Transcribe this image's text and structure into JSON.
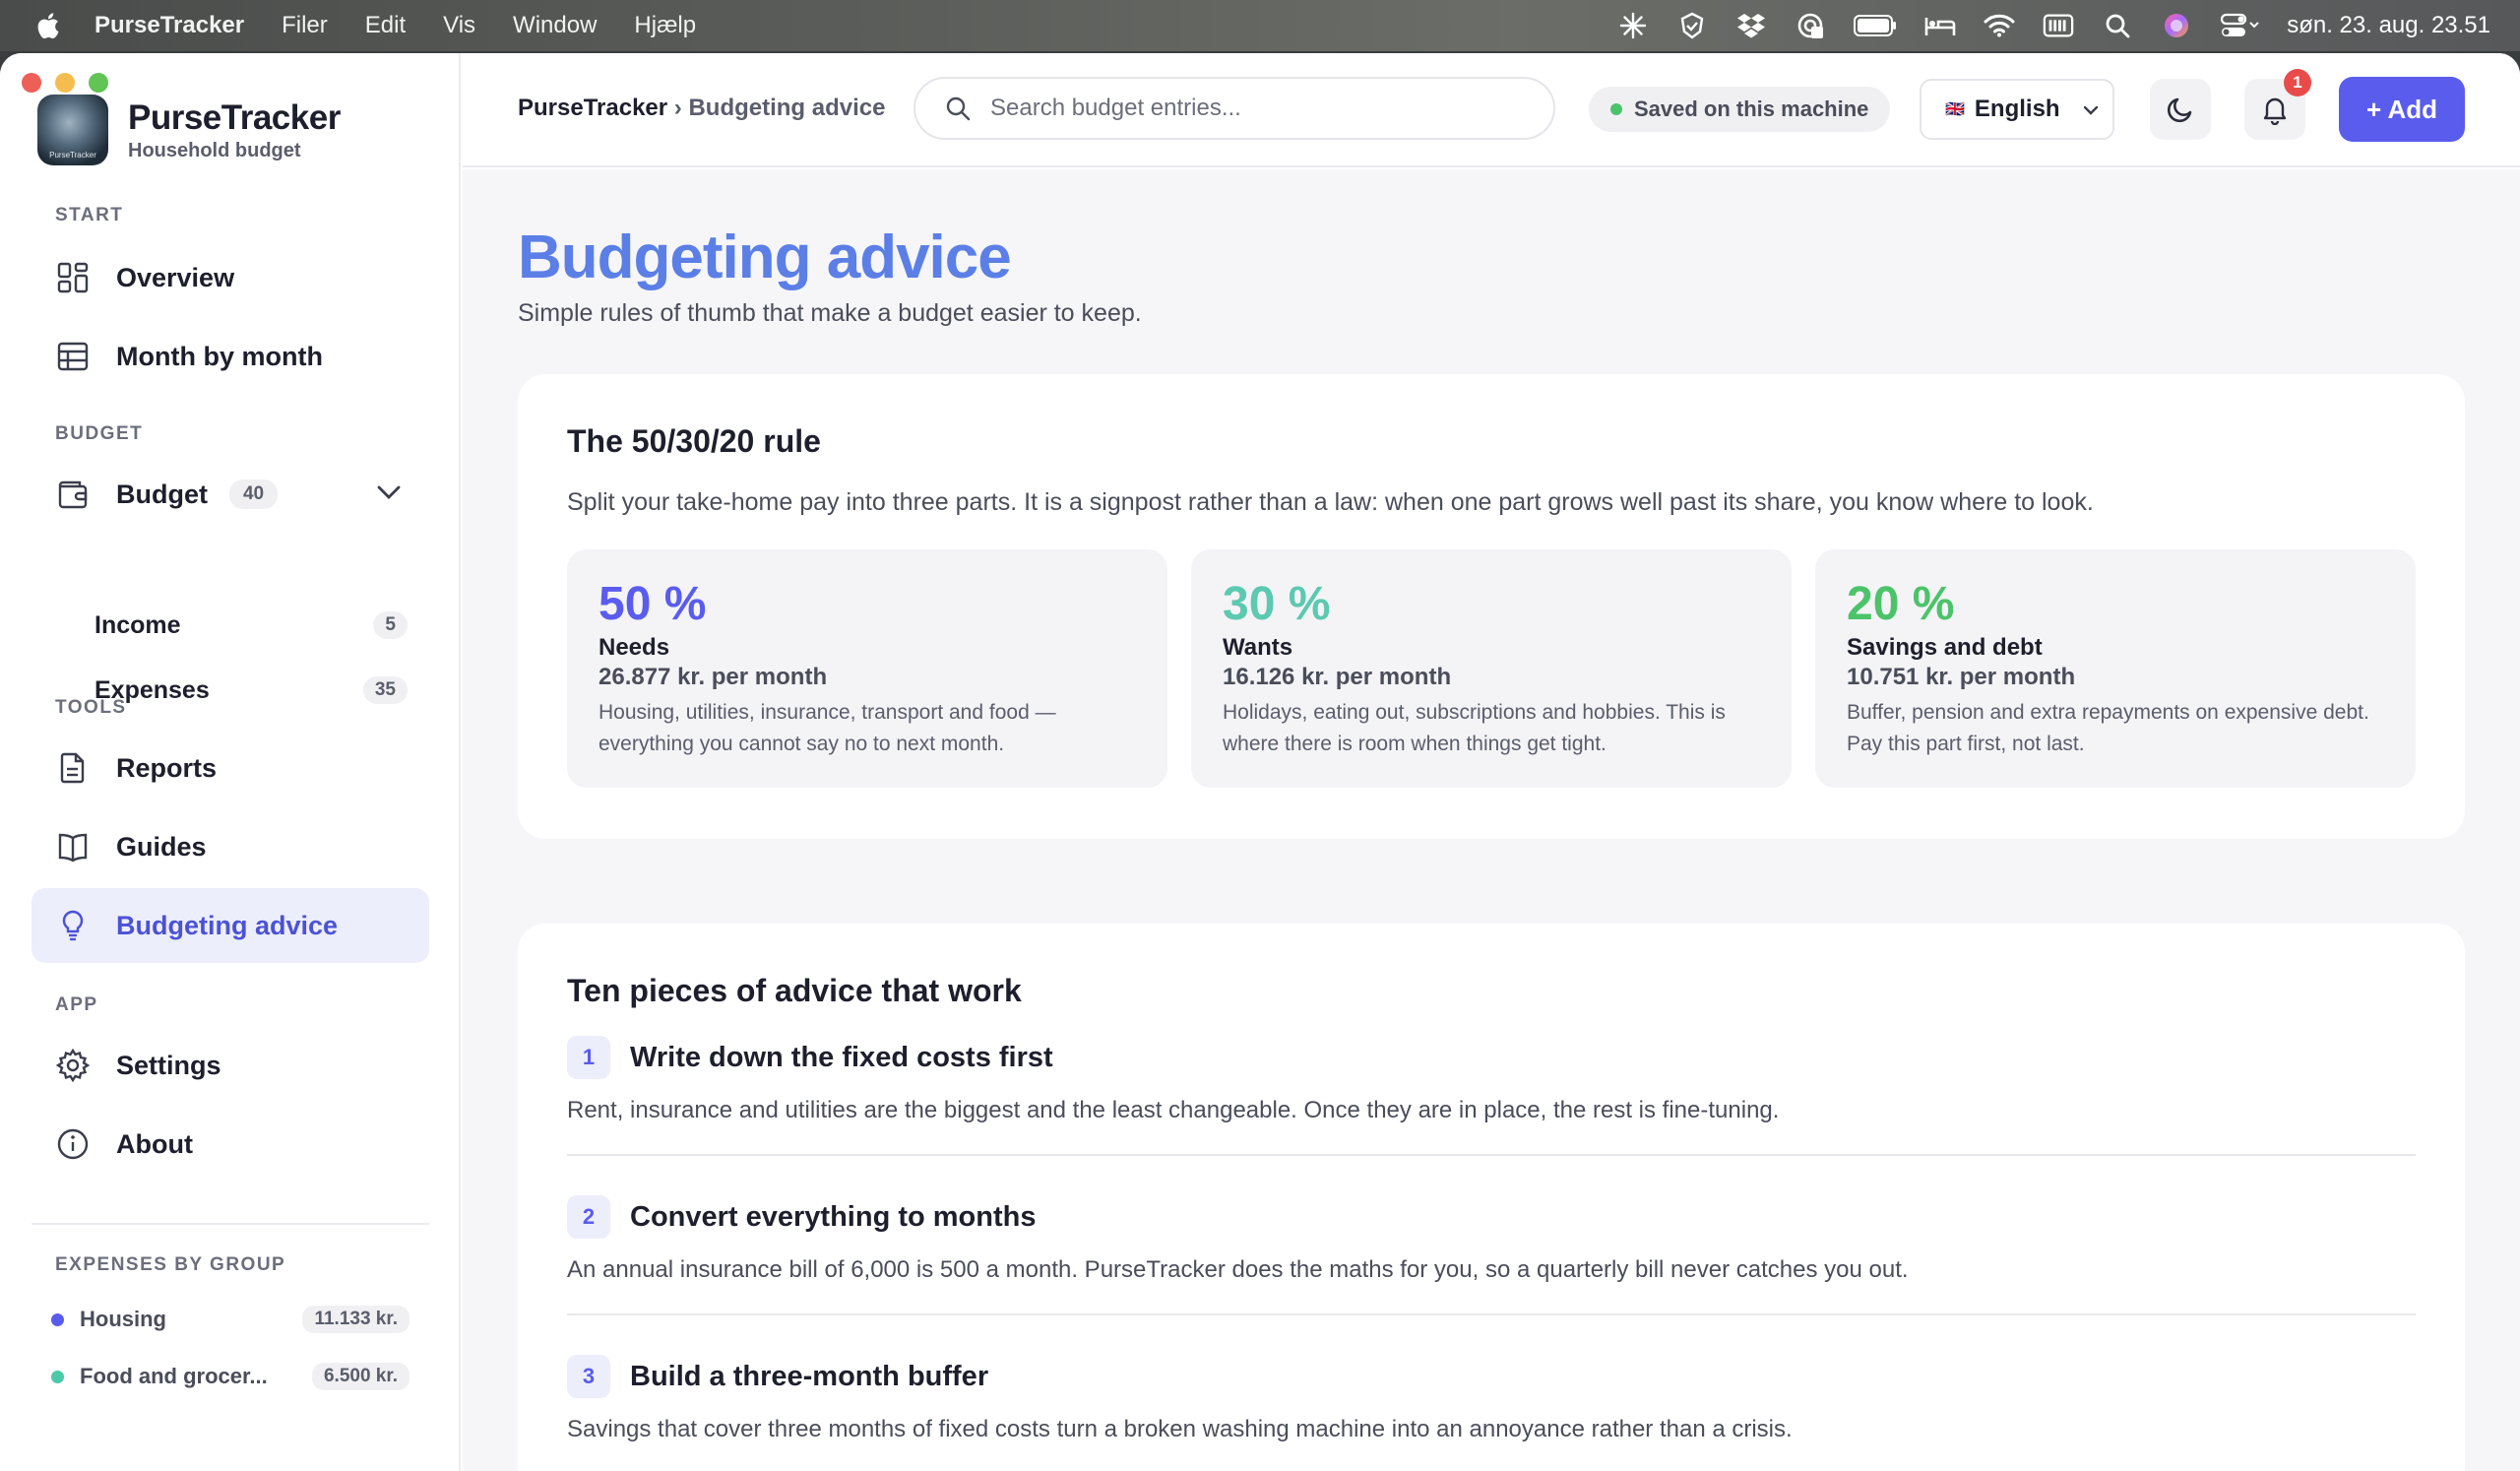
{
  "menubar": {
    "app_name": "PurseTracker",
    "menus": [
      "Filer",
      "Edit",
      "Vis",
      "Window",
      "Hjælp"
    ],
    "clock": "søn. 23. aug.  23.51"
  },
  "brand": {
    "name": "PurseTracker",
    "subtitle": "Household budget",
    "logo_text": "PurseTracker"
  },
  "sidebar": {
    "sections": {
      "start": "START",
      "budget": "BUDGET",
      "tools": "TOOLS",
      "app": "APP",
      "expenses_by_group": "EXPENSES BY GROUP"
    },
    "items": {
      "overview": "Overview",
      "month_by_month": "Month by month",
      "budget": "Budget",
      "budget_count": "40",
      "income": "Income",
      "income_count": "5",
      "expenses": "Expenses",
      "expenses_count": "35",
      "reports": "Reports",
      "guides": "Guides",
      "budgeting_advice": "Budgeting advice",
      "settings": "Settings",
      "about": "About"
    },
    "groups": [
      {
        "label": "Housing",
        "amount": "11.133 kr.",
        "color": "#5a5cee"
      },
      {
        "label": "Food and grocer...",
        "amount": "6.500 kr.",
        "color": "#4cc9a8"
      }
    ]
  },
  "topbar": {
    "breadcrumb_root": "PurseTracker",
    "breadcrumb_sep": "›",
    "breadcrumb_current": "Budgeting advice",
    "search_placeholder": "Search budget entries...",
    "saved_status": "Saved on this machine",
    "language": "English",
    "flag": "🇬🇧",
    "notification_count": "1",
    "add_label": "+ Add"
  },
  "page": {
    "title": "Budgeting advice",
    "subtitle": "Simple rules of thumb that make a budget easier to keep."
  },
  "rule": {
    "title": "The 50/30/20 rule",
    "description": "Split your take-home pay into three parts. It is a signpost rather than a law: when one part grows well past its share, you know where to look.",
    "parts": [
      {
        "pct": "50 %",
        "name": "Needs",
        "amount": "26.877 kr. per month",
        "text": "Housing, utilities, insurance, transport and food — everything you cannot say no to next month.",
        "color": "#5a5cee"
      },
      {
        "pct": "30 %",
        "name": "Wants",
        "amount": "16.126 kr. per month",
        "text": "Holidays, eating out, subscriptions and hobbies. This is where there is room when things get tight.",
        "color": "#5cc9b0"
      },
      {
        "pct": "20 %",
        "name": "Savings and debt",
        "amount": "10.751 kr. per month",
        "text": "Buffer, pension and extra repayments on expensive debt. Pay this part first, not last.",
        "color": "#4cc36a"
      }
    ]
  },
  "advice": {
    "title": "Ten pieces of advice that work",
    "items": [
      {
        "num": "1",
        "title": "Write down the fixed costs first",
        "text": "Rent, insurance and utilities are the biggest and the least changeable. Once they are in place, the rest is fine-tuning."
      },
      {
        "num": "2",
        "title": "Convert everything to months",
        "text": "An annual insurance bill of 6,000 is 500 a month. PurseTracker does the maths for you, so a quarterly bill never catches you out."
      },
      {
        "num": "3",
        "title": "Build a three-month buffer",
        "text": "Savings that cover three months of fixed costs turn a broken washing machine into an annoyance rather than a crisis."
      }
    ]
  }
}
